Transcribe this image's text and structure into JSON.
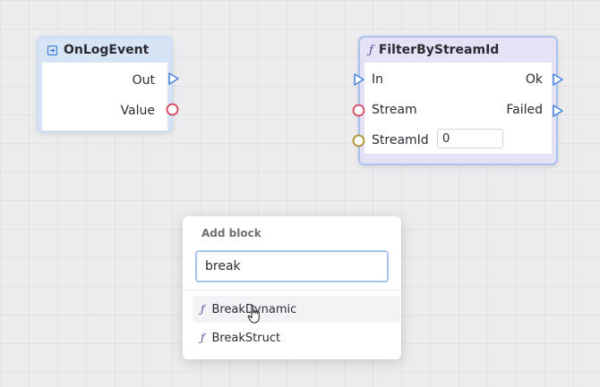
{
  "nodes": {
    "onlog": {
      "title": "OnLogEvent",
      "icon": "event-icon",
      "pins": {
        "out": "Out",
        "value": "Value"
      }
    },
    "filter": {
      "title": "FilterByStreamId",
      "icon": "function-icon",
      "pins": {
        "in": "In",
        "ok": "Ok",
        "failed": "Failed",
        "stream": "Stream",
        "stream_id": "StreamId"
      },
      "stream_id_value": "0"
    }
  },
  "add_block": {
    "title": "Add block",
    "search_value": "break",
    "results": [
      {
        "label": "BreakDynamic",
        "icon": "function-icon"
      },
      {
        "label": "BreakStruct",
        "icon": "function-icon"
      }
    ]
  },
  "colors": {
    "exec_pin": "#4a86e0",
    "data_pin_value": "#d6455f",
    "data_pin_stream": "#d6455f",
    "data_pin_streamid": "#b08d2e",
    "node_selected_border": "#a7c2ec"
  }
}
